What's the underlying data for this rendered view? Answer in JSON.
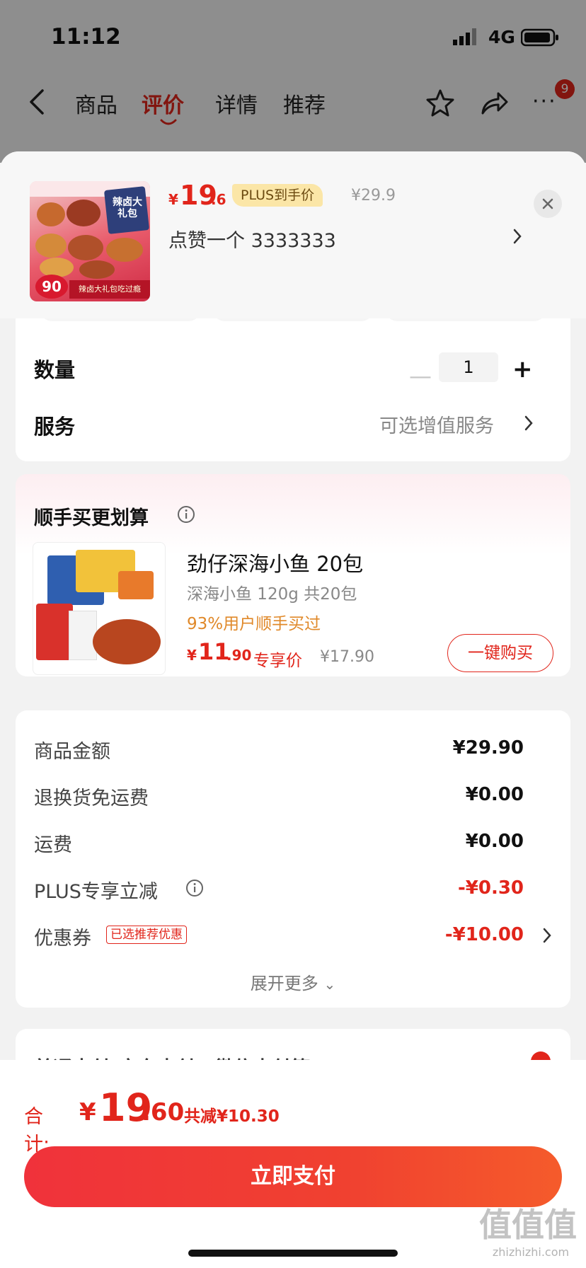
{
  "status_bar": {
    "time": "11:12",
    "network": "4G"
  },
  "nav": {
    "tabs": [
      {
        "label": "商品",
        "active": false
      },
      {
        "label": "评价",
        "active": true
      },
      {
        "label": "详情",
        "active": false
      },
      {
        "label": "推荐",
        "active": false
      }
    ],
    "more_badge": "9",
    "icons": [
      "back-arrow-icon",
      "star-icon",
      "share-icon",
      "more-icon"
    ]
  },
  "product": {
    "price_int": "19",
    "price_dec": ".6",
    "plus_tag": "PLUS到手价",
    "old_price": "¥29.9",
    "sku": "点赞一个  3333333",
    "thumb_badge": "90",
    "thumb_box_text": "辣卤大礼包",
    "thumb_banner": "辣卤大礼包吃过瘾"
  },
  "options": {
    "quantity_label": "数量",
    "quantity_value": "1",
    "service_label": "服务",
    "service_hint": "可选增值服务"
  },
  "addon": {
    "title": "顺手买更划算",
    "name": "劲仔深海小鱼 20包",
    "spec": "深海小鱼 120g 共20包",
    "rate": "93%用户顺手买过",
    "price_int": "11",
    "price_dec": ".90",
    "price_label": "专享价",
    "old_price": "¥17.90",
    "buy_label": "一键购买"
  },
  "amounts": {
    "rows": [
      {
        "label": "商品金额",
        "value": "¥29.90",
        "highlight": false
      },
      {
        "label": "退换货免运费",
        "value": "¥0.00",
        "highlight": false
      },
      {
        "label": "运费",
        "value": "¥0.00",
        "highlight": false
      },
      {
        "label": "PLUS专享立减",
        "value": "-¥0.30",
        "highlight": true
      },
      {
        "label": "优惠券",
        "value": "-¥10.00",
        "highlight": true
      }
    ],
    "coupon_tag": "已选推荐优惠",
    "expand_label": "展开更多"
  },
  "payment_peek": {
    "text": "普通支付(京东支付、微信支付等)"
  },
  "footer": {
    "total_label": "合计:",
    "total_yen": "¥",
    "total_int": "19",
    "total_dec": ".60",
    "saving": "共减¥10.30",
    "pay_label": "立即支付"
  },
  "watermark": {
    "main": "值值值",
    "sub": "zhizhizhi.com"
  },
  "colors": {
    "accent": "#e1251b",
    "plus_tag_bg": "#fbe6a7",
    "background": "#f2f2f2"
  }
}
